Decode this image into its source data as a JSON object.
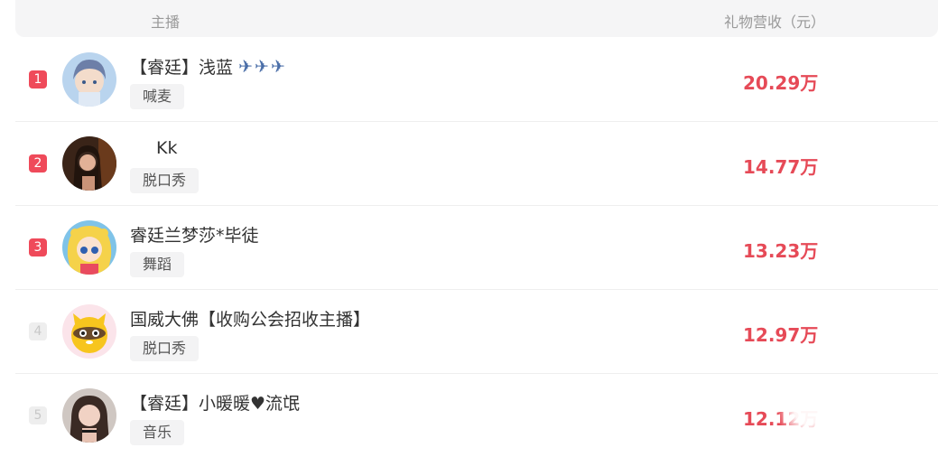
{
  "header": {
    "col_anchor": "主播",
    "col_revenue": "礼物营收（元）"
  },
  "rows": [
    {
      "rank": "1",
      "name": "【睿廷】浅蓝",
      "emojis": "✈✈✈",
      "tag": "喊麦",
      "amount": "20.29万",
      "avatar": "anime-boy"
    },
    {
      "rank": "2",
      "name": "Kk",
      "emojis": "",
      "tag": "脱口秀",
      "amount": "14.77万",
      "avatar": "photo-woman"
    },
    {
      "rank": "3",
      "name": "睿廷兰梦莎*毕徒",
      "emojis": "",
      "tag": "舞蹈",
      "amount": "13.23万",
      "avatar": "sailor-anime"
    },
    {
      "rank": "4",
      "name": "国威大佛【收购公会招收主播】",
      "emojis": "",
      "tag": "脱口秀",
      "amount": "12.97万",
      "avatar": "yellow-mascot"
    },
    {
      "rank": "5",
      "name": "【睿廷】小暖暖♥流氓",
      "emojis": "",
      "tag": "音乐",
      "amount": "12.12万",
      "avatar": "photo-woman-2"
    }
  ]
}
